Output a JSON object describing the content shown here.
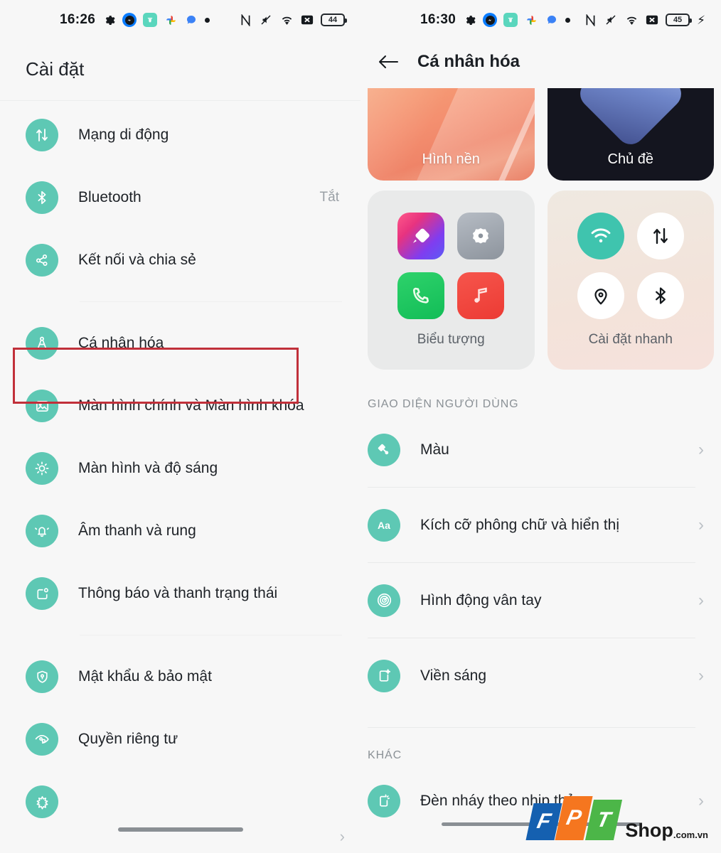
{
  "left": {
    "status_bar": {
      "time": "16:26",
      "app_icons": [
        "gear-icon",
        "messenger-icon",
        "shopee-icon",
        "photos-icon",
        "blue-app-icon",
        "dot-icon"
      ],
      "system_icons": [
        "nfc-icon",
        "mute-icon",
        "wifi-icon",
        "no-sim-icon"
      ],
      "battery_percent": "44"
    },
    "title": "Cài đặt",
    "items": [
      {
        "label": "Mạng di động",
        "value": "",
        "icon": "mobile-network-icon"
      },
      {
        "label": "Bluetooth",
        "value": "Tắt",
        "icon": "bluetooth-icon"
      },
      {
        "label": "Kết nối và chia sẻ",
        "value": "",
        "icon": "connection-share-icon"
      },
      {
        "label": "Cá nhân hóa",
        "value": "",
        "icon": "personalization-icon"
      },
      {
        "label": "Màn hình chính và Màn hình khóa",
        "value": "",
        "icon": "home-lock-screen-icon"
      },
      {
        "label": "Màn hình và độ sáng",
        "value": "",
        "icon": "display-brightness-icon"
      },
      {
        "label": "Âm thanh và rung",
        "value": "",
        "icon": "sound-vibration-icon"
      },
      {
        "label": "Thông báo và thanh trạng thái",
        "value": "",
        "icon": "notification-statusbar-icon"
      },
      {
        "label": "Mật khẩu & bảo mật",
        "value": "",
        "icon": "password-security-icon"
      },
      {
        "label": "Quyền riêng tư",
        "value": "",
        "icon": "privacy-icon"
      }
    ],
    "highlight_color": "#c1303a",
    "accent_color": "#5ec8b4"
  },
  "right": {
    "status_bar": {
      "time": "16:30",
      "battery_percent": "45",
      "charging": "⚡"
    },
    "title": "Cá nhân hóa",
    "top_cards": [
      {
        "label": "Hình nền",
        "kind": "wallpaper-card"
      },
      {
        "label": "Chủ đề",
        "kind": "theme-card"
      }
    ],
    "bottom_cards": [
      {
        "label": "Biểu tượng",
        "kind": "icons-card"
      },
      {
        "label": "Cài đặt nhanh",
        "kind": "quick-settings-card"
      }
    ],
    "sections": [
      {
        "heading": "GIAO DIỆN NGƯỜI DÙNG",
        "items": [
          {
            "label": "Màu",
            "icon": "paint-roller-icon"
          },
          {
            "label": "Kích cỡ phông chữ và hiển thị",
            "icon": "font-size-icon"
          },
          {
            "label": "Hình động vân tay",
            "icon": "fingerprint-animation-icon"
          },
          {
            "label": "Viền sáng",
            "icon": "edge-lighting-icon"
          }
        ]
      },
      {
        "heading": "KHÁC",
        "items": [
          {
            "label": "Đèn nháy theo nhịp thở",
            "icon": "breathing-light-icon"
          }
        ]
      }
    ],
    "chevron": "›"
  },
  "watermark": {
    "f": "F",
    "p": "P",
    "t": "T",
    "shop": "Shop",
    "tld": ".com.vn"
  }
}
